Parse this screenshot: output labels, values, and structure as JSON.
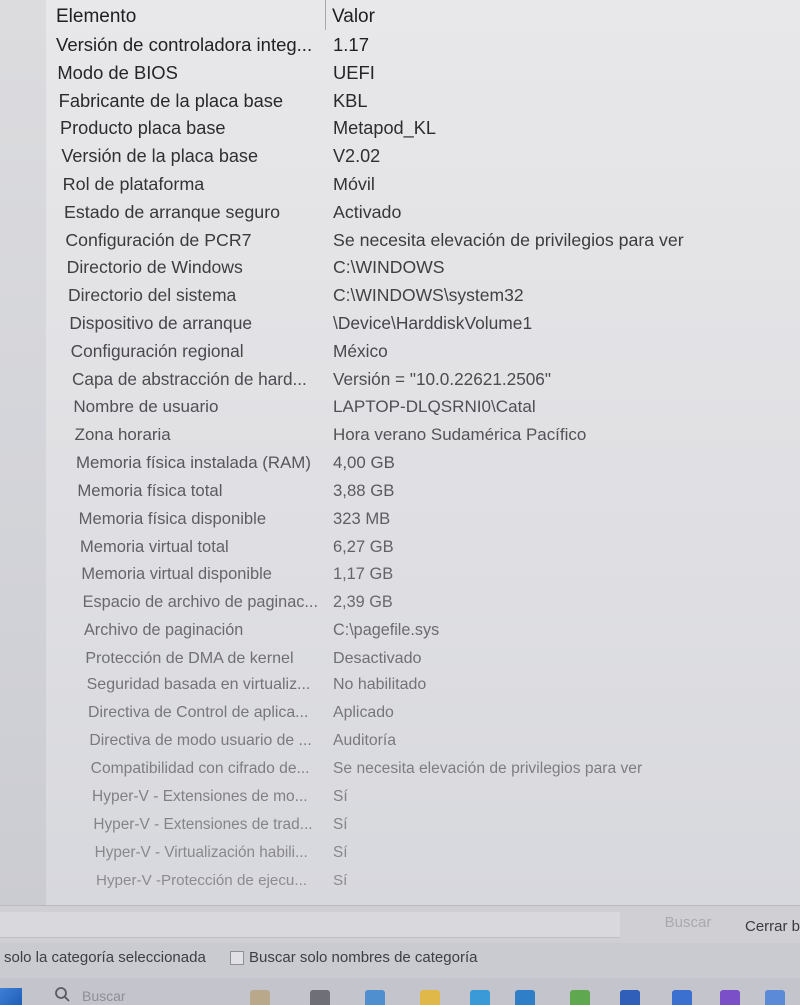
{
  "header": {
    "col_item": "Elemento",
    "col_value": "Valor"
  },
  "rows": [
    {
      "item": "Versión de controladora integ...",
      "value": "1.17"
    },
    {
      "item": "Modo de BIOS",
      "value": "UEFI"
    },
    {
      "item": "Fabricante de la placa base",
      "value": "KBL"
    },
    {
      "item": "Producto placa base",
      "value": "Metapod_KL"
    },
    {
      "item": "Versión de la placa base",
      "value": "V2.02"
    },
    {
      "item": "Rol de plataforma",
      "value": "Móvil"
    },
    {
      "item": "Estado de arranque seguro",
      "value": "Activado"
    },
    {
      "item": "Configuración de PCR7",
      "value": "Se necesita elevación de privilegios para ver"
    },
    {
      "item": "Directorio de Windows",
      "value": "C:\\WINDOWS"
    },
    {
      "item": "Directorio del sistema",
      "value": "C:\\WINDOWS\\system32"
    },
    {
      "item": "Dispositivo de arranque",
      "value": "\\Device\\HarddiskVolume1"
    },
    {
      "item": "Configuración regional",
      "value": "México"
    },
    {
      "item": "Capa de abstracción de hard...",
      "value": "Versión = \"10.0.22621.2506\""
    },
    {
      "item": "Nombre de usuario",
      "value": "LAPTOP-DLQSRNI0\\Catal"
    },
    {
      "item": "Zona horaria",
      "value": "Hora verano Sudamérica Pacífico"
    },
    {
      "item": "Memoria física instalada (RAM)",
      "value": "4,00 GB"
    },
    {
      "item": "Memoria física total",
      "value": "3,88 GB"
    },
    {
      "item": "Memoria física disponible",
      "value": "323 MB"
    },
    {
      "item": "Memoria virtual total",
      "value": "6,27 GB"
    },
    {
      "item": "Memoria virtual disponible",
      "value": "1,17 GB"
    },
    {
      "item": "Espacio de archivo de paginac...",
      "value": "2,39 GB"
    },
    {
      "item": "Archivo de paginación",
      "value": "C:\\pagefile.sys"
    },
    {
      "item": "Protección de DMA de kernel",
      "value": "Desactivado"
    },
    {
      "item": "Seguridad basada en virtualiz...",
      "value": "No habilitado"
    },
    {
      "item": "Directiva de Control de aplica...",
      "value": "Aplicado"
    },
    {
      "item": "Directiva de modo usuario de ...",
      "value": "Auditoría"
    },
    {
      "item": "Compatibilidad con cifrado de...",
      "value": "Se necesita elevación de privilegios para ver"
    },
    {
      "item": "Hyper-V - Extensiones de mo...",
      "value": "Sí"
    },
    {
      "item": "Hyper-V - Extensiones de trad...",
      "value": "Sí"
    },
    {
      "item": "Hyper-V - Virtualización habili...",
      "value": "Sí"
    },
    {
      "item": "Hyper-V -Protección de ejecu...",
      "value": "Sí"
    }
  ],
  "find": {
    "find_button": "Buscar",
    "close_button": "Cerrar b"
  },
  "options": {
    "selected_category_only": "solo la categoría seleccionada",
    "search_category_names_only": "Buscar solo nombres de categoría"
  },
  "taskbar": {
    "search_placeholder": "Buscar"
  }
}
